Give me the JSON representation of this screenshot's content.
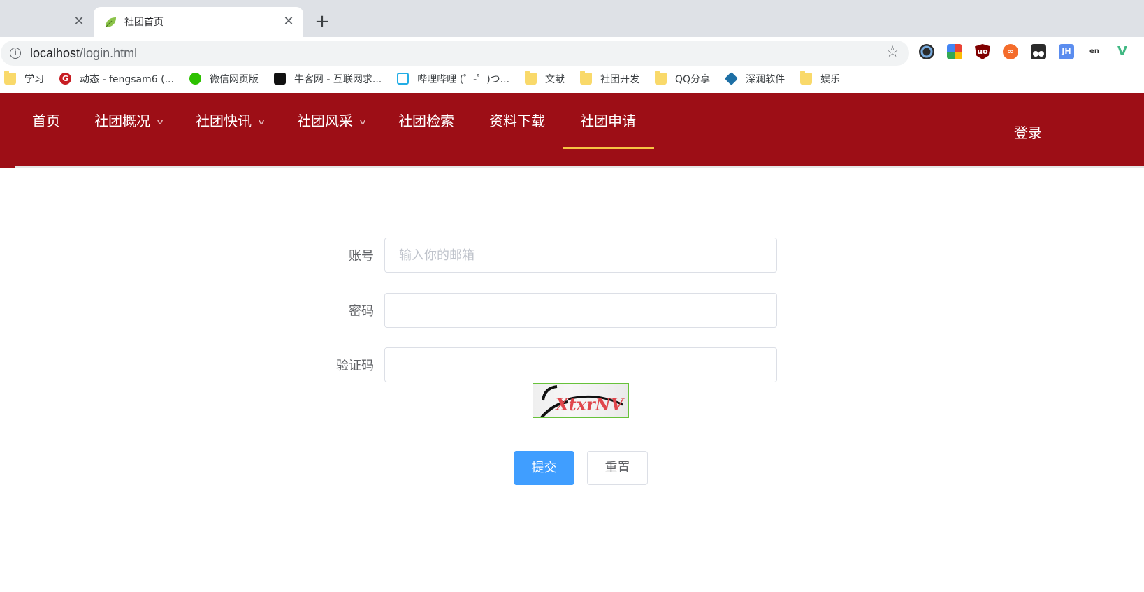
{
  "browser": {
    "tabs": [
      {
        "title": "",
        "active": false
      },
      {
        "title": "社团首页",
        "active": true
      }
    ],
    "new_tab_icon": "plus-icon",
    "url_host": "localhost",
    "url_path": "/login.html",
    "bookmarks": [
      {
        "label": "学习",
        "icon": "folder-icon"
      },
      {
        "label": "动态 - fengsam6 (...",
        "icon": "gitee-icon"
      },
      {
        "label": "微信网页版",
        "icon": "wechat-icon"
      },
      {
        "label": "牛客网 - 互联网求...",
        "icon": "nowcoder-icon"
      },
      {
        "label": "哔哩哔哩 (゜-゜)つ...",
        "icon": "bilibili-icon"
      },
      {
        "label": "文献",
        "icon": "folder-icon"
      },
      {
        "label": "社团开发",
        "icon": "folder-icon"
      },
      {
        "label": "QQ分享",
        "icon": "folder-icon"
      },
      {
        "label": "深澜软件",
        "icon": "srun-icon"
      },
      {
        "label": "娱乐",
        "icon": "folder-icon"
      }
    ],
    "extensions": [
      {
        "name": "color-picker-extension-icon",
        "label": "",
        "color": "#2b2b2b"
      },
      {
        "name": "google-translate-extension-icon",
        "label": "",
        "color": "#34a853"
      },
      {
        "name": "ublock-extension-icon",
        "label": "uo",
        "color": "#800000"
      },
      {
        "name": "infinity-extension-icon",
        "label": "∞",
        "color": "#f46c2b"
      },
      {
        "name": "tampermonkey-extension-icon",
        "label": "",
        "color": "#2b2b2b"
      },
      {
        "name": "jh-extension-icon",
        "label": "JH",
        "color": "#5b8def"
      },
      {
        "name": "translate-extension-icon",
        "label": "en",
        "color": "#ffffff"
      },
      {
        "name": "vue-devtools-extension-icon",
        "label": "V",
        "color": "#41b883"
      }
    ]
  },
  "nav": {
    "items": [
      {
        "label": "首页",
        "dropdown": false
      },
      {
        "label": "社团概况",
        "dropdown": true
      },
      {
        "label": "社团快讯",
        "dropdown": true
      },
      {
        "label": "社团风采",
        "dropdown": true
      },
      {
        "label": "社团检索",
        "dropdown": false
      },
      {
        "label": "资料下载",
        "dropdown": false
      },
      {
        "label": "社团申请",
        "dropdown": false
      }
    ],
    "active_item": "社团申请",
    "login_label": "登录",
    "background_color": "#9d0e16",
    "accent_color": "#f6c343"
  },
  "login_form": {
    "account_label": "账号",
    "account_placeholder": "输入你的邮箱",
    "account_value": "",
    "password_label": "密码",
    "password_value": "",
    "captcha_label": "验证码",
    "captcha_value": "",
    "captcha_text": "XtxrNV",
    "submit_label": "提交",
    "reset_label": "重置",
    "primary_color": "#409eff"
  }
}
